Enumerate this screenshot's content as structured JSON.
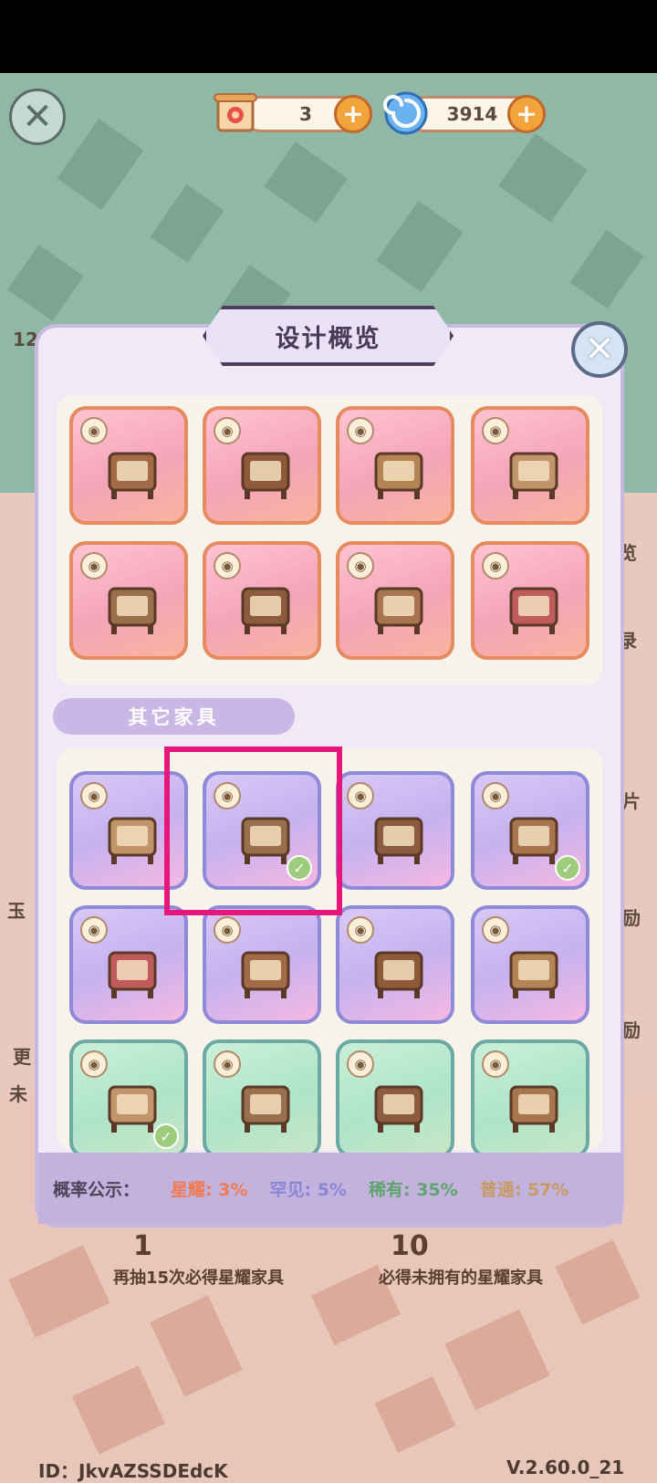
{
  "currency": {
    "ticket_count": "3",
    "orb_count": "3914"
  },
  "modal": {
    "title": "设计概览",
    "section_other": "其它家具",
    "top_cards": [
      {
        "icon": "cabinet-bed-icon",
        "tier": "star"
      },
      {
        "icon": "clothes-rack-icon",
        "tier": "star"
      },
      {
        "icon": "armchair-icon",
        "tier": "star"
      },
      {
        "icon": "daybed-sofa-icon",
        "tier": "star"
      },
      {
        "icon": "canopy-bed-icon",
        "tier": "star"
      },
      {
        "icon": "folding-screen-icon",
        "tier": "star"
      },
      {
        "icon": "wall-window-icon",
        "tier": "star"
      },
      {
        "icon": "hanging-lantern-icon",
        "tier": "star"
      }
    ],
    "other_cards": [
      {
        "icon": "flower-swing-icon",
        "tier": "rare",
        "owned": false
      },
      {
        "icon": "tea-set-icon",
        "tier": "rare",
        "owned": true
      },
      {
        "icon": "jewelry-tree-icon",
        "tier": "rare",
        "owned": false
      },
      {
        "icon": "scroll-desk-icon",
        "tier": "rare",
        "owned": true
      },
      {
        "icon": "balloon-bunch-icon",
        "tier": "rare",
        "owned": false
      },
      {
        "icon": "flower-lamp-icon",
        "tier": "rare",
        "owned": false
      },
      {
        "icon": "carousel-icon",
        "tier": "rare",
        "owned": false
      },
      {
        "icon": "heart-decor-icon",
        "tier": "rare",
        "owned": false
      },
      {
        "icon": "cat-bag-icon",
        "tier": "green",
        "owned": true
      },
      {
        "icon": "cat-bag-brown-icon",
        "tier": "green",
        "owned": false
      },
      {
        "icon": "fox-plush-icon",
        "tier": "green",
        "owned": false
      },
      {
        "icon": "dollhouse-icon",
        "tier": "green",
        "owned": false
      }
    ],
    "check_mark": "✓",
    "eye_symbol": "◉"
  },
  "probability": {
    "title": "概率公示：",
    "items": [
      {
        "label": "星耀: 3%",
        "color": "#f17a52"
      },
      {
        "label": "罕见: 5%",
        "color": "#8a86d6"
      },
      {
        "label": "稀有: 35%",
        "color": "#5fa36e"
      },
      {
        "label": "普通: 57%",
        "color": "#c79a63"
      }
    ]
  },
  "pity": {
    "left_number": "1",
    "left_text": "再抽15次必得星耀家具",
    "right_number": "10",
    "right_text": "必得未拥有的星耀家具"
  },
  "side_labels": {
    "label_1": "览",
    "label_2": "录",
    "label_3": "片",
    "label_4": "励",
    "label_5": "励",
    "label_6": "12",
    "label_7": "玉",
    "label_8": "更",
    "label_9": "未"
  },
  "footer": {
    "id": "ID：JkvAZSSDEdcK",
    "version": "V.2.60.0_21"
  },
  "glyphs": {
    "close": "✕",
    "plus": "+"
  }
}
